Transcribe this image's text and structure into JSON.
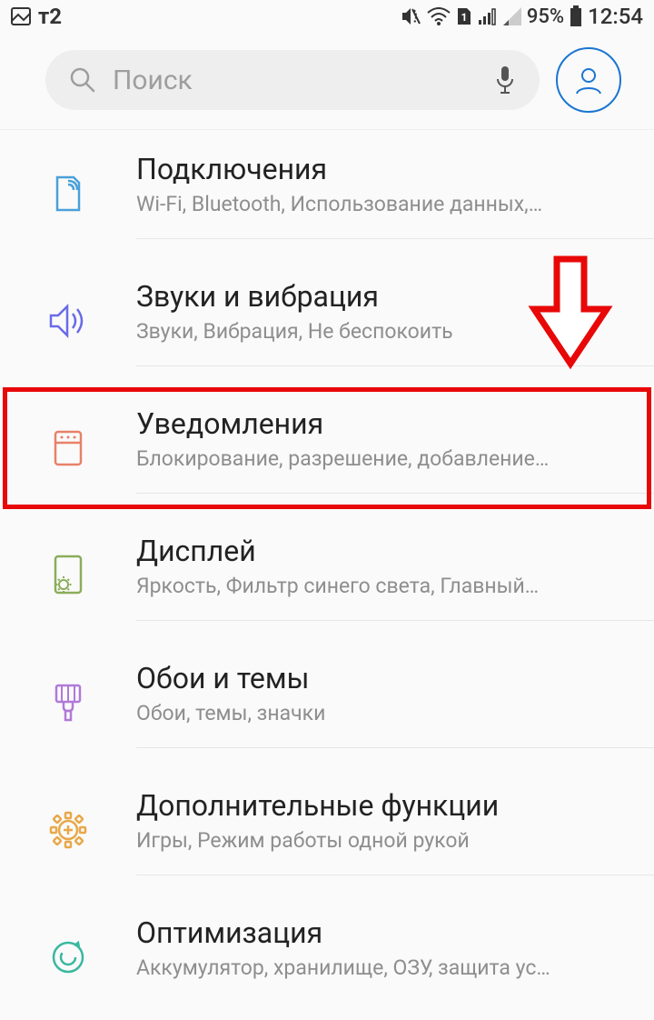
{
  "status": {
    "carrier": "т2",
    "battery_pct": "95%",
    "time": "12:54"
  },
  "search": {
    "placeholder": "Поиск"
  },
  "items": [
    {
      "title": "Подключения",
      "sub": "Wi-Fi, Bluetooth, Использование данных,…"
    },
    {
      "title": "Звуки и вибрация",
      "sub": "Звуки, Вибрация, Не беспокоить"
    },
    {
      "title": "Уведомления",
      "sub": "Блокирование, разрешение, добавление…"
    },
    {
      "title": "Дисплей",
      "sub": "Яркость, Фильтр синего света, Главный…"
    },
    {
      "title": "Обои и темы",
      "sub": "Обои, темы, значки"
    },
    {
      "title": "Дополнительные функции",
      "sub": "Игры, Режим работы одной рукой"
    },
    {
      "title": "Оптимизация",
      "sub": "Аккумулятор, хранилище, ОЗУ, защита ус…"
    }
  ]
}
